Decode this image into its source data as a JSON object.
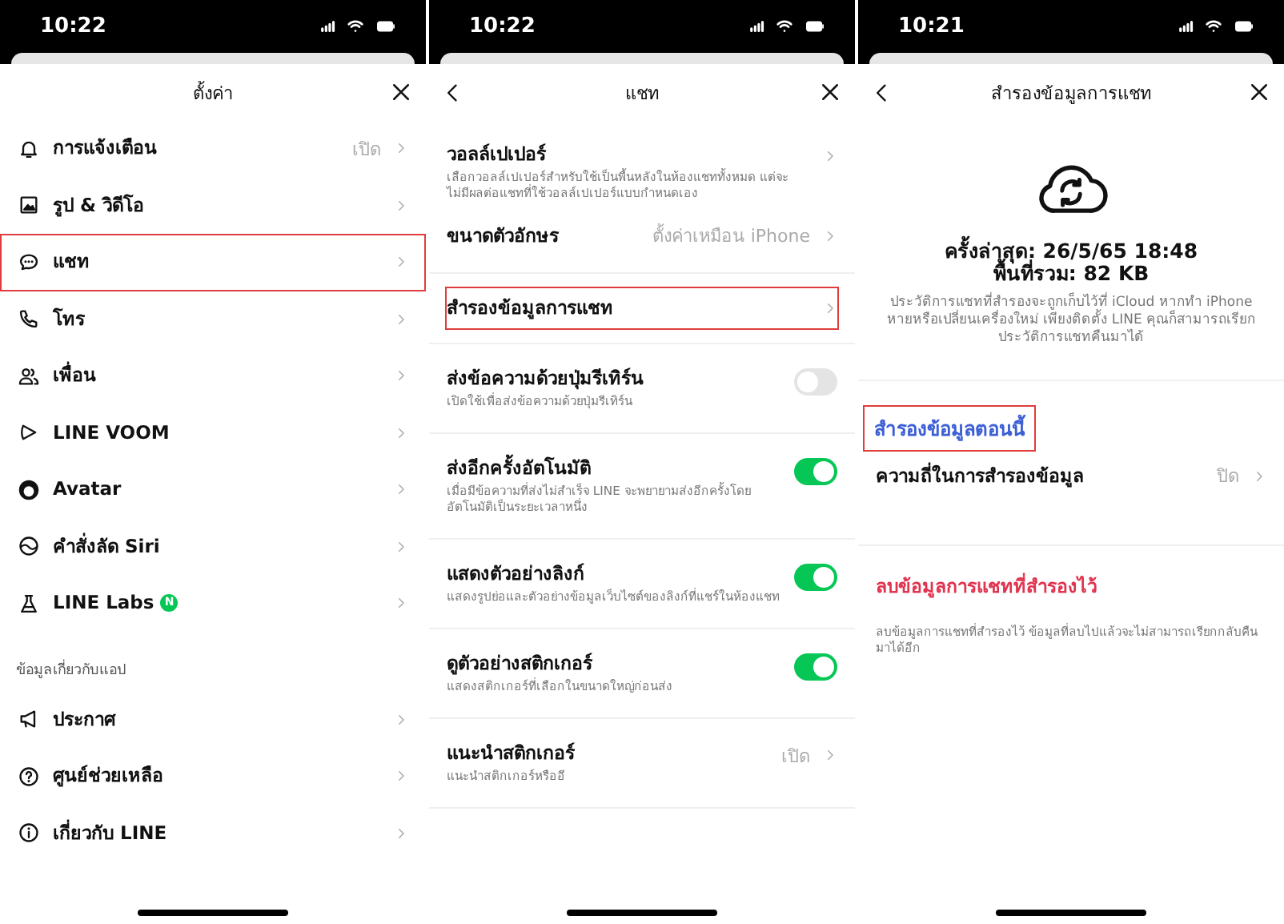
{
  "panels": [
    {
      "kind": "settings",
      "time": "10:22",
      "title": "ตั้งค่า",
      "back": false,
      "sections": [
        {
          "items": [
            {
              "kind": "nav",
              "label": "การแจ้งเตือน",
              "value": "เปิด",
              "highlighted": false
            },
            {
              "kind": "nav",
              "label": "รูป & วิดีโอ",
              "highlighted": false
            },
            {
              "kind": "nav",
              "label": "แชท",
              "highlighted": true
            },
            {
              "kind": "nav",
              "label": "โทร",
              "highlighted": false
            },
            {
              "kind": "nav",
              "label": "เพื่อน",
              "highlighted": false
            },
            {
              "kind": "nav",
              "label": "LINE VOOM",
              "highlighted": false
            },
            {
              "kind": "nav",
              "label": "Avatar",
              "highlighted": false
            },
            {
              "kind": "nav",
              "label": "คำสั่งลัด Siri",
              "highlighted": false
            },
            {
              "kind": "nav",
              "label": "LINE Labs",
              "badge": "N",
              "highlighted": false
            }
          ]
        },
        {
          "heading": "ข้อมูลเกี่ยวกับแอป",
          "items": [
            {
              "kind": "nav",
              "label": "ประกาศ",
              "highlighted": false
            },
            {
              "kind": "nav",
              "label": "ศูนย์ช่วยเหลือ",
              "highlighted": false
            },
            {
              "kind": "nav",
              "label": "เกี่ยวกับ LINE",
              "highlighted": false
            }
          ]
        }
      ]
    },
    {
      "kind": "chat",
      "time": "10:22",
      "title": "แชท",
      "back": true,
      "sections": [
        {
          "items": [
            {
              "kind": "nav",
              "label": "วอลล์เปเปอร์",
              "description": "เลือกวอลล์เปเปอร์สำหรับใช้เป็นพื้นหลังในห้องแชททั้งหมด แต่จะไม่มีผลต่อแชทที่ใช้วอลล์เปเปอร์แบบกำหนดเอง",
              "highlighted": false
            },
            {
              "kind": "nav",
              "label": "ขนาดตัวอักษร",
              "value": "ตั้งค่าเหมือน iPhone",
              "highlighted": false
            }
          ]
        },
        {
          "items": [
            {
              "kind": "nav",
              "label": "สำรองข้อมูลการแชท",
              "highlighted": true
            }
          ]
        },
        {
          "items": [
            {
              "kind": "toggle",
              "label": "ส่งข้อความด้วยปุ่มรีเทิร์น",
              "description": "เปิดใช้เพื่อส่งข้อความด้วยปุ่มรีเทิร์น",
              "on": false,
              "highlighted": false
            }
          ]
        },
        {
          "items": [
            {
              "kind": "toggle",
              "label": "ส่งอีกครั้งอัตโนมัติ",
              "description": "เมื่อมีข้อความที่ส่งไม่สำเร็จ LINE จะพยายามส่งอีกครั้งโดยอัตโนมัติเป็นระยะเวลาหนึ่ง",
              "on": true,
              "highlighted": false
            }
          ]
        },
        {
          "items": [
            {
              "kind": "toggle",
              "label": "แสดงตัวอย่างลิงก์",
              "description": "แสดงรูปย่อและตัวอย่างข้อมูลเว็บไซต์ของลิงก์ที่แชร์ในห้องแชท",
              "on": true,
              "highlighted": false
            }
          ]
        },
        {
          "items": [
            {
              "kind": "toggle",
              "label": "ดูตัวอย่างสติกเกอร์",
              "description": "แสดงสติกเกอร์ที่เลือกในขนาดใหญ่ก่อนส่ง",
              "on": true,
              "highlighted": false
            }
          ]
        },
        {
          "items": [
            {
              "kind": "nav",
              "label": "แนะนำสติกเกอร์",
              "value": "เปิด",
              "description": "แนะนำสติกเกอร์หรืออี",
              "highlighted": false
            }
          ]
        }
      ]
    },
    {
      "kind": "backup",
      "time": "10:21",
      "title": "สำรองข้อมูลการแชท",
      "back": true,
      "summary": {
        "last_backup": "ครั้งล่าสุด: 26/5/65 18:48",
        "total_size": "พื้นที่รวม: 82 KB",
        "description": "ประวัติการแชทที่สำรองจะถูกเก็บไว้ที่ iCloud หากทำ iPhone หายหรือเปลี่ยนเครื่องใหม่ เพียงติดตั้ง LINE คุณก็สามารถเรียกประวัติการแชทคืนมาได้"
      },
      "sections": [
        {
          "items": [
            {
              "kind": "action",
              "label": "สำรองข้อมูลตอนนี้",
              "highlighted": true
            },
            {
              "kind": "nav",
              "label": "ความถี่ในการสำรองข้อมูล",
              "value": "ปิด",
              "highlighted": false
            }
          ]
        },
        {
          "items": [
            {
              "kind": "danger",
              "label": "ลบข้อมูลการแชทที่สำรองไว้",
              "description": "ลบข้อมูลการแชทที่สำรองไว้ ข้อมูลที่ลบไปแล้วจะไม่สามารถเรียกกลับคืนมาได้อีก",
              "highlighted": false
            }
          ]
        }
      ]
    }
  ]
}
